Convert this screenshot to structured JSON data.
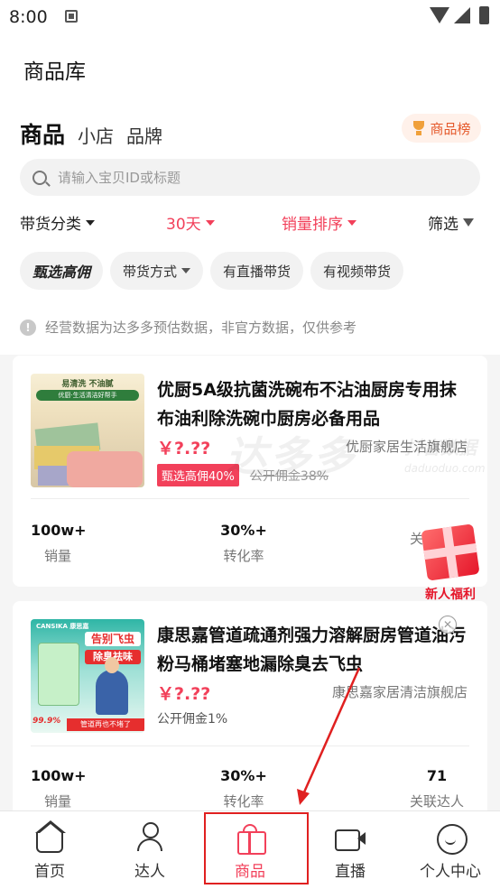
{
  "status_bar": {
    "time": "8:00"
  },
  "header": {
    "title": "商品库"
  },
  "tabs": [
    {
      "label": "商品",
      "active": true
    },
    {
      "label": "小店",
      "active": false
    },
    {
      "label": "品牌",
      "active": false
    }
  ],
  "rank_button": {
    "label": "商品榜"
  },
  "search": {
    "placeholder": "请输入宝贝ID或标题"
  },
  "filters": {
    "category": "带货分类",
    "days": "30天",
    "sort": "销量排序",
    "screen": "筛选"
  },
  "chips": [
    "甄选高佣",
    "带货方式",
    "有直播带货",
    "有视频带货"
  ],
  "notice": "经营数据为达多多预估数据，非官方数据，仅供参考",
  "products": [
    {
      "name": "优厨5A级抗菌洗碗布不沾油厨房专用抹布油利除洗碗巾厨房必备用品",
      "price": "￥?.??",
      "shop": "优厨家居生活旗舰店",
      "tag": "甄选高佣40%",
      "commission": "公开佣金38%",
      "thumb_text1": "易清洗 不油腻",
      "thumb_text2": "优厨·生活清洁好帮手",
      "stats": [
        {
          "value": "100w+",
          "label": "销量"
        },
        {
          "value": "30%+",
          "label": "转化率"
        },
        {
          "value": "",
          "label": "关联达人"
        }
      ]
    },
    {
      "name": "康思嘉管道疏通剂强力溶解厨房管道油污粉马桶堵塞地漏除臭去飞虫",
      "price": "￥?.??",
      "shop": "康思嘉家居清洁旗舰店",
      "commission": "公开佣金1%",
      "thumb_brand": "CANSIKA 康思嘉",
      "thumb_red1": "告别飞虫",
      "thumb_red2": "除臭祛味",
      "thumb_pct": "99.9%",
      "thumb_strip": "管道再也不堵了",
      "stats": [
        {
          "value": "100w+",
          "label": "销量"
        },
        {
          "value": "30%+",
          "label": "转化率"
        },
        {
          "value": "71",
          "label": "关联达人"
        }
      ]
    }
  ],
  "gift_popup": {
    "label": "新人福利"
  },
  "watermark": {
    "main": "达多多",
    "sub": "抖音数据",
    "url": "daduoduo.com"
  },
  "bottom_nav": [
    {
      "label": "首页",
      "icon": "home-icon",
      "active": false
    },
    {
      "label": "达人",
      "icon": "user-check-icon",
      "active": false
    },
    {
      "label": "商品",
      "icon": "gift-icon",
      "active": true
    },
    {
      "label": "直播",
      "icon": "video-camera-icon",
      "active": false
    },
    {
      "label": "个人中心",
      "icon": "smiley-icon",
      "active": false
    }
  ],
  "colors": {
    "accent": "#f2405a",
    "annotation": "#e02020",
    "rank_text": "#e55a2c"
  }
}
